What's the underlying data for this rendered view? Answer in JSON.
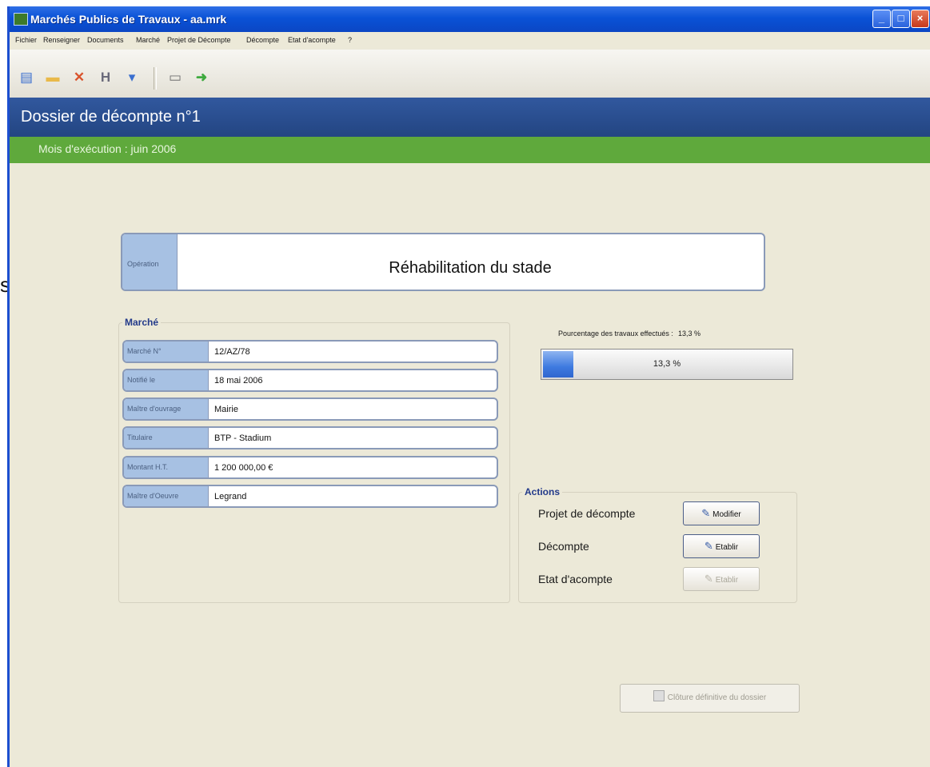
{
  "window": {
    "title": "Marchés Publics de Travaux - aa.mrk"
  },
  "menu": [
    "Fichier",
    "Renseigner",
    "Documents",
    "Marché",
    "Projet de Décompte",
    "Décompte",
    "Etat d'acompte",
    "?"
  ],
  "toolbar": {
    "icons": [
      "new-document-icon",
      "open-folder-icon",
      "delete-icon",
      "h-tool-icon",
      "print-icon",
      "next-arrow-icon"
    ]
  },
  "header": {
    "title": "Dossier de décompte n°1",
    "subtitle": "Mois d'exécution : juin 2006"
  },
  "operation": {
    "label": "Opération",
    "value": "Réhabilitation du stade"
  },
  "marche": {
    "title": "Marché",
    "fields": [
      {
        "label": "Marché N°",
        "value": "12/AZ/78"
      },
      {
        "label": "Notifié le",
        "value": "18 mai 2006"
      },
      {
        "label": "Maître d'ouvrage",
        "value": "Mairie"
      },
      {
        "label": "Titulaire",
        "value": "BTP - Stadium"
      },
      {
        "label": "Montant H.T.",
        "value": "1 200 000,00 €"
      },
      {
        "label": "Maître d'Oeuvre",
        "value": "Legrand"
      }
    ]
  },
  "progress": {
    "label": "Pourcentage des travaux effectués :",
    "value_text": "13,3 %",
    "percent": 13.3
  },
  "actions": {
    "title": "Actions",
    "rows": [
      {
        "label": "Projet de décompte",
        "button": "Modifier",
        "enabled": true
      },
      {
        "label": "Décompte",
        "button": "Etablir",
        "enabled": true
      },
      {
        "label": "Etat d'acompte",
        "button": "Etablir",
        "enabled": false
      }
    ]
  },
  "footer": {
    "close_button": "Clôture définitive du dossier"
  },
  "stray_text": "s",
  "colors": {
    "title_blue": "#0a52d6",
    "header_blue": "#2a4d8f",
    "header_green": "#5fa93c",
    "label_fill": "#a7c1e3"
  }
}
